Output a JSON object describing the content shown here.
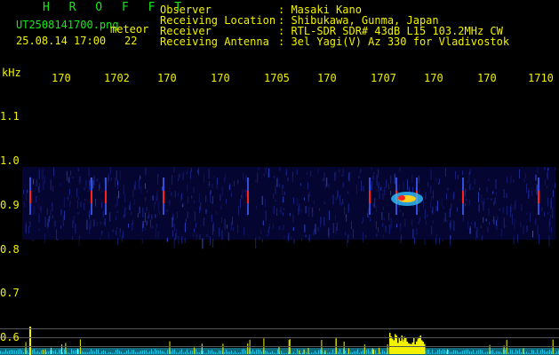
{
  "header": {
    "station_title": "H R O F F T",
    "file_name": "UT2508141700.png",
    "meteor_label": "meteor",
    "datetime": "25.08.14 17:00",
    "count": "22",
    "info": [
      {
        "label": "Observer",
        "value": ": Masaki Kano"
      },
      {
        "label": "Receiving Location",
        "value": ": Shibukawa, Gunma, Japan"
      },
      {
        "label": "Receiver",
        "value": ": RTL-SDR SDR# 43dB L15 103.2MHz CW"
      },
      {
        "label": "Receiving Antenna",
        "value": ": 3el Yagi(V) Az 330 for Vladivostok"
      }
    ]
  },
  "axes": {
    "y_unit": "kHz",
    "y_ticks": [
      "1.1",
      "1.0",
      "0.9",
      "0.8",
      "0.7",
      "0.6"
    ],
    "x_ticks": [
      "170",
      "1702",
      "170",
      "170",
      "1705",
      "170",
      "1707",
      "170",
      "170",
      "1710"
    ]
  },
  "colors": {
    "text_green": "#17e817",
    "text_yellow": "#f2f200",
    "background": "#000000",
    "signal_band": "#0a0a5a",
    "meteor_echo": "#ff2020",
    "level_trace": "#f2f200",
    "noise_floor": "#20c0e0"
  }
}
